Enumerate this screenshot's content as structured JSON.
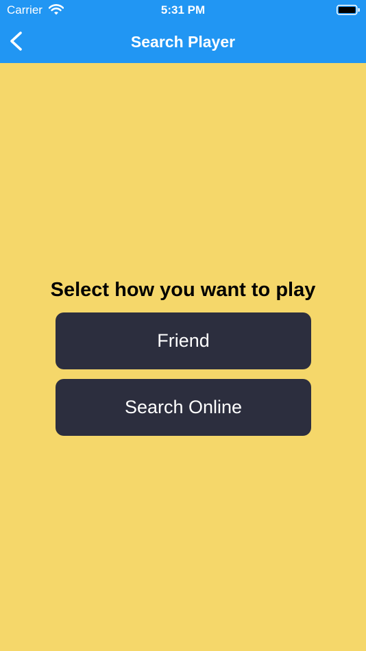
{
  "status_bar": {
    "carrier": "Carrier",
    "time": "5:31 PM",
    "wifi_icon": "wifi-icon",
    "battery_icon": "battery-icon"
  },
  "nav": {
    "title": "Search Player",
    "back_icon": "chevron-left-icon"
  },
  "main": {
    "prompt": "Select how you want to play",
    "options": [
      {
        "label": "Friend"
      },
      {
        "label": "Search Online"
      }
    ]
  },
  "colors": {
    "nav_background": "#2196F3",
    "page_background": "#F5D76A",
    "button_background": "#2C2E3E",
    "button_text": "#FFFFFF"
  }
}
